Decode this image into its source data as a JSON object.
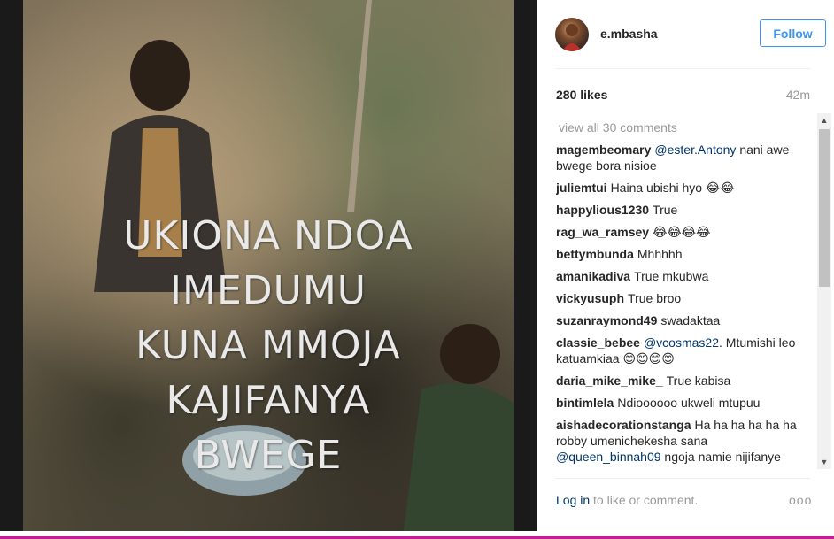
{
  "post": {
    "image_alt_icon": "photo",
    "meme_lines": [
      "UKIONA NDOA",
      "IMEDUMU",
      "KUNA MMOJA",
      "KAJIFANYA",
      "BWEGE"
    ]
  },
  "header": {
    "username": "e.mbasha",
    "follow_label": "Follow"
  },
  "stats": {
    "likes": "280 likes",
    "time_ago": "42m"
  },
  "comments": {
    "view_all": "view all 30 comments",
    "items": [
      {
        "author": "magembeomary",
        "mention": "@ester.Antony",
        "text": " nani awe bwege bora nisioe"
      },
      {
        "author": "juliemtui",
        "mention": "",
        "text": "Haina ubishi hyo 😂😂"
      },
      {
        "author": "happylious1230",
        "mention": "",
        "text": "True"
      },
      {
        "author": "rag_wa_ramsey",
        "mention": "",
        "text": "😂😂😂😂"
      },
      {
        "author": "bettymbunda",
        "mention": "",
        "text": "Mhhhhh"
      },
      {
        "author": "amanikadiva",
        "mention": "",
        "text": "True mkubwa"
      },
      {
        "author": "vickyusuph",
        "mention": "",
        "text": "True broo"
      },
      {
        "author": "suzanraymond49",
        "mention": "",
        "text": "swadaktaa"
      },
      {
        "author": "classie_bebee",
        "mention": "@vcosmas22",
        "text": ". Mtumishi leo katuamkiaa 😊😊😊😊"
      },
      {
        "author": "daria_mike_mike_",
        "mention": "",
        "text": "True kabisa"
      },
      {
        "author": "bintimlela",
        "mention": "",
        "text": "Ndioooooo ukweli mtupuu"
      },
      {
        "author": "aishadecorationstanga",
        "mention": "",
        "text": "Ha ha ha ha ha ha robby umenichekesha sana",
        "mention2": "@queen_binnah09",
        "text2": " ngoja namie nijifanye"
      }
    ]
  },
  "footer": {
    "login_link": "Log in",
    "login_suffix": " to like or comment.",
    "more_icon": "ooo"
  },
  "colors": {
    "accent": "#3897f0",
    "link": "#003569",
    "muted": "#999999",
    "bottom_bar": "#c31c97"
  }
}
